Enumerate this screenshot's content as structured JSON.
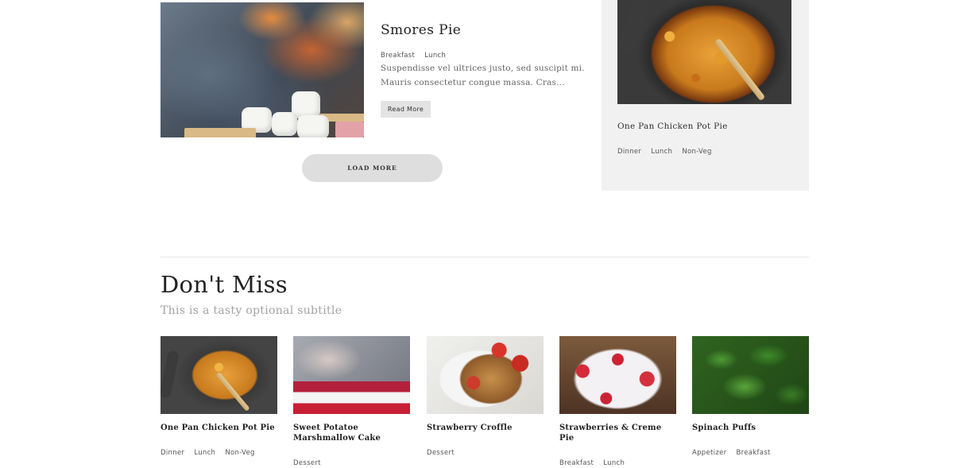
{
  "featured_post": {
    "title": "Smores Pie",
    "tags": [
      "Breakfast",
      "Lunch"
    ],
    "excerpt_line1": "Suspendisse vel ultrices justo, sed suscipit mi.",
    "excerpt_line2": "Mauris consectetur congue massa. Cras...",
    "read_more_label": "Read More"
  },
  "load_more_label": "LOAD MORE",
  "sidebar_card": {
    "title": "One Pan Chicken Pot Pie",
    "tags": [
      "Dinner",
      "Lunch",
      "Non-Veg"
    ]
  },
  "dont_miss": {
    "title": "Don't Miss",
    "subtitle": "This is a tasty optional subtitle",
    "cards": [
      {
        "title": "One Pan Chicken Pot Pie",
        "tags": [
          "Dinner",
          "Lunch",
          "Non-Veg"
        ]
      },
      {
        "title": "Sweet Potatoe Marshmallow Cake",
        "tags": [
          "Dessert"
        ]
      },
      {
        "title": "Strawberry Croffle",
        "tags": [
          "Dessert"
        ]
      },
      {
        "title": "Strawberries & Creme Pie",
        "tags": [
          "Breakfast",
          "Lunch"
        ]
      },
      {
        "title": "Spinach Puffs",
        "tags": [
          "Appetizer",
          "Breakfast"
        ]
      }
    ]
  }
}
